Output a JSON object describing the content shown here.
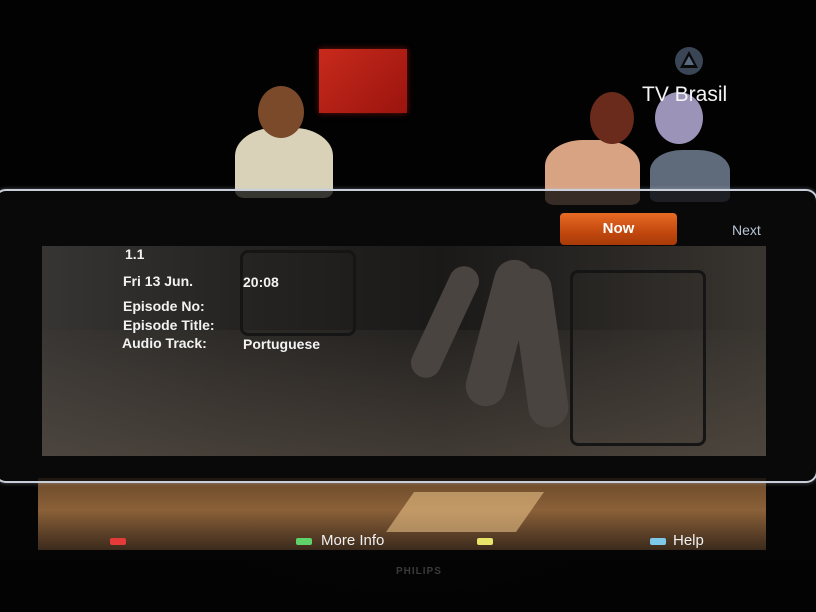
{
  "channel": {
    "logo_text": "TV Brasil",
    "logo_icon": "tv-brasil-logo-icon"
  },
  "tabs": {
    "now_label": "Now",
    "next_label": "Next",
    "active": "Now"
  },
  "program_info": {
    "channel_number": "1.1",
    "date": "Fri 13 Jun.",
    "time": "20:08",
    "episode_no_label": "Episode No:",
    "episode_title_label": "Episode Title:",
    "audio_track_label": "Audio Track:",
    "audio_track_value": "Portuguese"
  },
  "color_keys": [
    {
      "color": "red",
      "hex": "#e43a3a",
      "label": ""
    },
    {
      "color": "green",
      "hex": "#5fd26a",
      "label": "More Info"
    },
    {
      "color": "yellow",
      "hex": "#e8e46a",
      "label": ""
    },
    {
      "color": "blue",
      "hex": "#7ec8ea",
      "label": "Help"
    }
  ],
  "tv_brand": "PHILIPS",
  "colors": {
    "accent_orange": "#d9571a",
    "panel_border": "#c8cfd8",
    "next_text": "#b8c4d4"
  }
}
